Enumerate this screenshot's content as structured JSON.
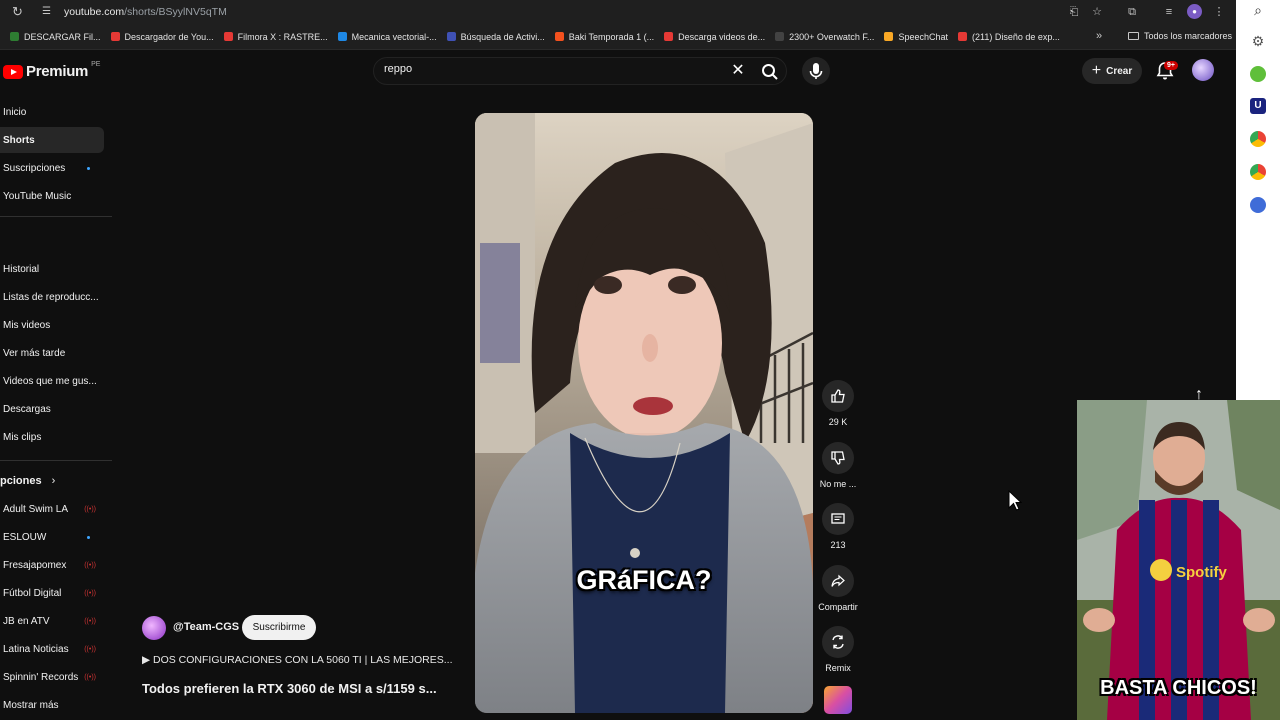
{
  "browser": {
    "url_domain": "youtube.com",
    "url_path": "/shorts/BSyylNV5qTM",
    "bookmarks": [
      {
        "label": "DESCARGAR Fil...",
        "color": "#2e7d32"
      },
      {
        "label": "Descargador de You...",
        "color": "#e53935"
      },
      {
        "label": "Filmora X : RASTRE...",
        "color": "#e53935"
      },
      {
        "label": "Mecanica vectorial-...",
        "color": "#1e88e5"
      },
      {
        "label": "Búsqueda de Activi...",
        "color": "#3f51b5"
      },
      {
        "label": "Baki Temporada 1 (...",
        "color": "#f4511e"
      },
      {
        "label": "Descarga videos de...",
        "color": "#e53935"
      },
      {
        "label": "2300+ Overwatch F...",
        "color": "#424242"
      },
      {
        "label": "SpeechChat",
        "color": "#f9a825"
      },
      {
        "label": "(211) Diseño de exp...",
        "color": "#e53935"
      }
    ],
    "bookmarks_more": "»",
    "all_bookmarks": "Todos los marcadores"
  },
  "header": {
    "logo_text": "Premium",
    "country_code": "PE",
    "search_value": "reppo",
    "create_label": "Crear",
    "notifications_badge": "9+"
  },
  "sidebar": {
    "primary": [
      "Inicio",
      "Shorts",
      "Suscripciones",
      "YouTube Music"
    ],
    "active": "Shorts",
    "you": [
      "Historial",
      "Listas de reproducc...",
      "Mis videos",
      "Ver más tarde",
      "Videos que me gus...",
      "Descargas",
      "Mis clips"
    ],
    "subscriptions_heading": "pciones",
    "subscriptions": [
      {
        "name": "Adult Swim LA",
        "status": "live"
      },
      {
        "name": "ESLOUW",
        "status": "new"
      },
      {
        "name": "Fresajapomex",
        "status": "live"
      },
      {
        "name": "Fútbol Digital",
        "status": "live"
      },
      {
        "name": "JB en ATV",
        "status": "live"
      },
      {
        "name": "Latina Noticias",
        "status": "live"
      },
      {
        "name": "Spinnin' Records",
        "status": "live"
      }
    ],
    "show_more": "Mostrar más"
  },
  "short": {
    "caption": "GRáFICA?",
    "channel": "@Team-CGS",
    "subscribe_label": "Suscribirme",
    "description": "▶ DOS CONFIGURACIONES CON LA 5060 TI | LAS MEJORES...",
    "title": "Todos prefieren la RTX 3060 de MSI a s/1159 s..."
  },
  "actions": {
    "like_count": "29 K",
    "dislike_label": "No me ...",
    "comments_count": "213",
    "share_label": "Compartir",
    "remix_label": "Remix"
  },
  "overlay": {
    "caption": "BASTA CHICOS!",
    "shirt_text": "Spotify"
  }
}
